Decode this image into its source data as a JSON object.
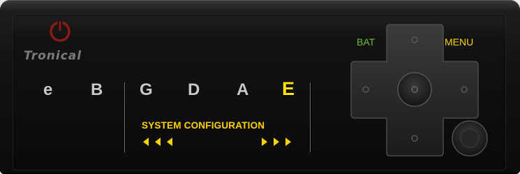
{
  "brand": {
    "name": "Tronical"
  },
  "tuner": {
    "strings": [
      {
        "label": "e",
        "active": false
      },
      {
        "label": "B",
        "active": false
      },
      {
        "label": "G",
        "active": false
      },
      {
        "label": "D",
        "active": false
      },
      {
        "label": "A",
        "active": false
      },
      {
        "label": "E",
        "active": true
      }
    ],
    "mode_label": "SYSTEM CONFIGURATION"
  },
  "controls": {
    "bat_label": "BAT",
    "menu_label": "MENU"
  },
  "icons": {
    "logo": "power-icon",
    "left": "triple-arrow-left-icon",
    "right": "triple-arrow-right-icon"
  },
  "colors": {
    "active_string": "#ffe500",
    "inactive_string": "#c8c8c8",
    "mode_label": "#ffd200",
    "bat": "#6fbf2a",
    "menu": "#ffd400",
    "logo_red": "#9e1b14"
  }
}
